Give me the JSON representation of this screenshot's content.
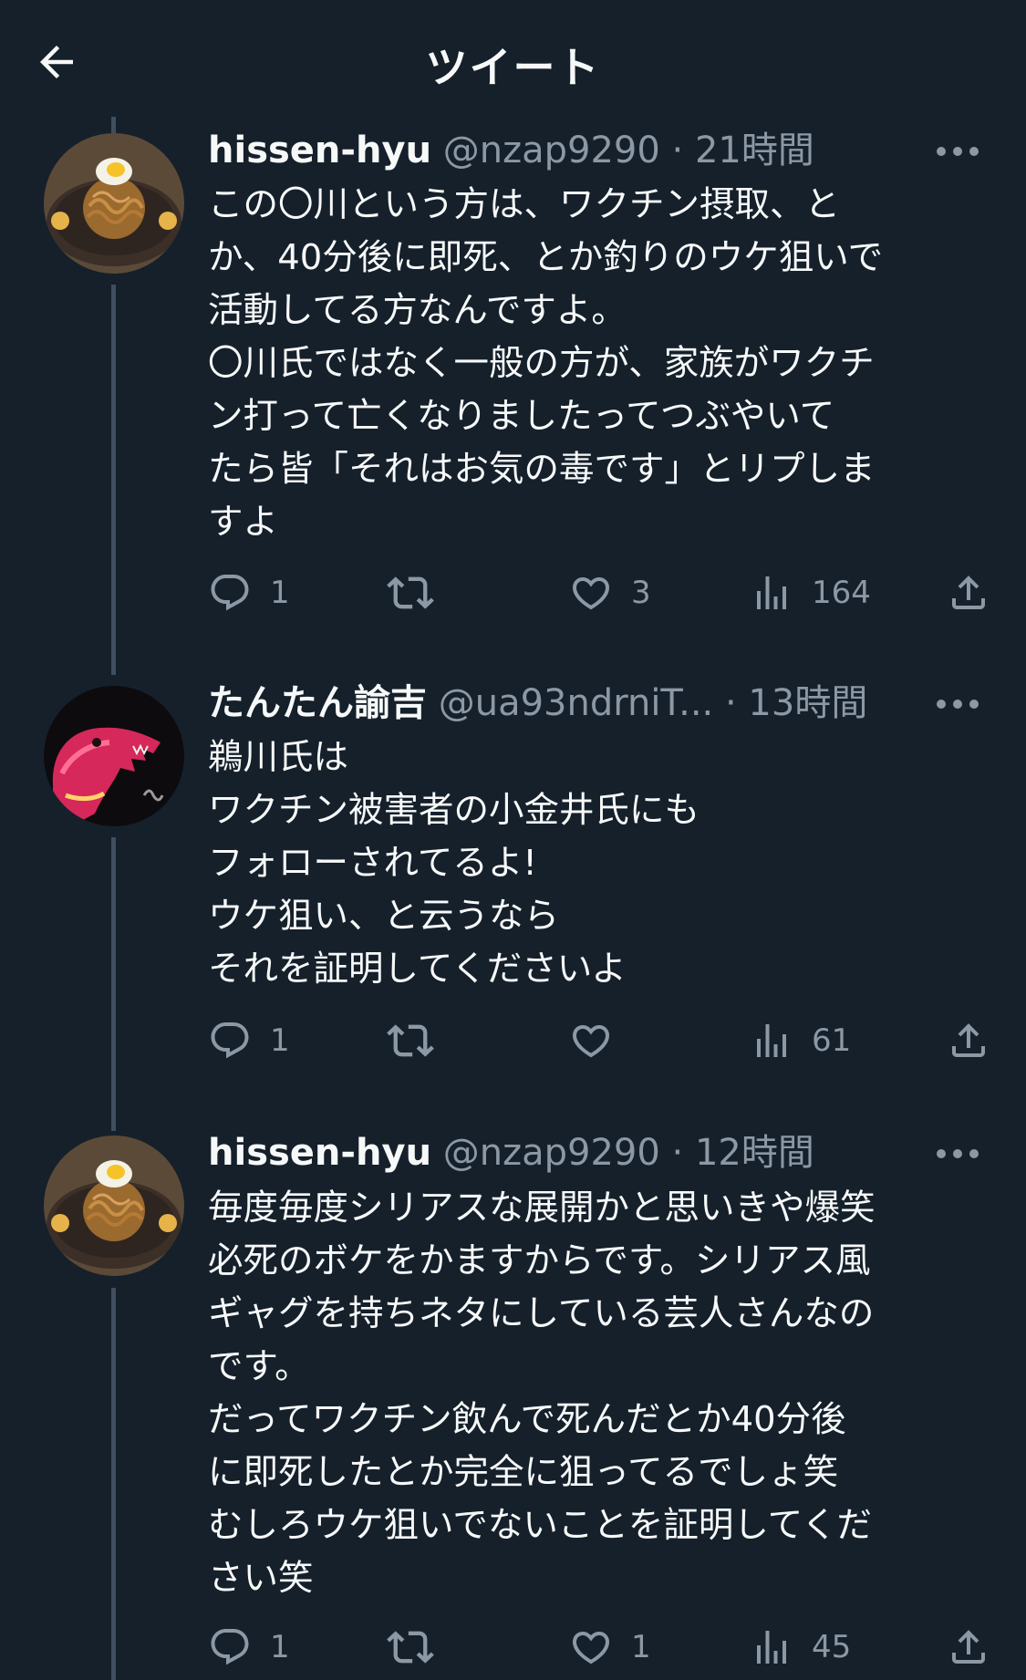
{
  "header": {
    "title": "ツイート",
    "back_icon": "back-arrow-icon"
  },
  "colors": {
    "background": "#15202b",
    "text": "#f7f9f9",
    "muted": "#8b98a5",
    "thread_line": "#3f4f5e"
  },
  "tweets": [
    {
      "display_name": "hissen-hyu",
      "handle": "@nzap9290",
      "separator": "·",
      "time": "21時間",
      "avatar": "noodle-dish-avatar",
      "body_lines": [
        "この〇川という方は、ワクチン摂取、と",
        "か、40分後に即死、とか釣りのウケ狙いで",
        "活動してる方なんですよ。",
        "〇川氏ではなく一般の方が、家族がワクチ",
        "ン打って亡くなりましたってつぶやいて",
        "たら皆「それはお気の毒です」とリプしま",
        "すよ"
      ],
      "replies": "1",
      "retweets": "",
      "likes": "3",
      "views": "164"
    },
    {
      "display_name": "たんたん諭吉",
      "handle": "@ua93ndrniT...",
      "separator": "·",
      "time": "13時間",
      "avatar": "dinosaur-avatar",
      "body_lines": [
        "鵜川氏は",
        "ワクチン被害者の小金井氏にも",
        "フォローされてるよ!",
        "ウケ狙い、と云うなら",
        "それを証明してくださいよ"
      ],
      "replies": "1",
      "retweets": "",
      "likes": "",
      "views": "61"
    },
    {
      "display_name": "hissen-hyu",
      "handle": "@nzap9290",
      "separator": "·",
      "time": "12時間",
      "avatar": "noodle-dish-avatar",
      "body_lines": [
        "毎度毎度シリアスな展開かと思いきや爆笑",
        "必死のボケをかますからです。シリアス風",
        "ギャグを持ちネタにしている芸人さんなの",
        "です。",
        "だってワクチン飲んで死んだとか40分後",
        "に即死したとか完全に狙ってるでしょ笑",
        "むしろウケ狙いでないことを証明してくだ",
        "さい笑"
      ],
      "replies": "1",
      "retweets": "",
      "likes": "1",
      "views": "45"
    }
  ]
}
